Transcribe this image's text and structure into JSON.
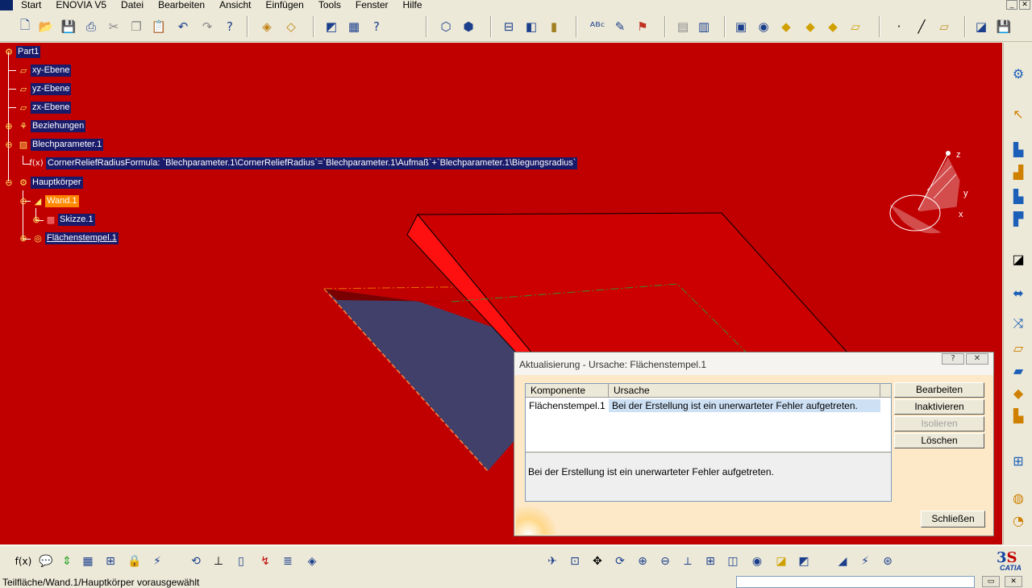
{
  "menu": {
    "items": [
      "Start",
      "ENOVIA V5",
      "Datei",
      "Bearbeiten",
      "Ansicht",
      "Einfügen",
      "Tools",
      "Fenster",
      "Hilfe"
    ]
  },
  "tree": {
    "root": "Part1",
    "items": [
      "xy-Ebene",
      "yz-Ebene",
      "zx-Ebene",
      "Beziehungen",
      "Blechparameter.1",
      "CornerReliefRadiusFormula: `Blechparameter.1\\CornerReliefRadius`=`Blechparameter.1\\Aufmaß`+`Blechparameter.1\\Biegungsradius`",
      "Hauptkörper",
      "Wand.1",
      "Skizze.1",
      "Flächenstempel.1"
    ]
  },
  "compass": {
    "z": "z",
    "y": "y",
    "x": "x"
  },
  "dialog": {
    "title": "Aktualisierung - Ursache: Flächenstempel.1",
    "help_label": "?",
    "close_label": "✕",
    "columns": [
      "Komponente",
      "Ursache"
    ],
    "row": {
      "component": "Flächenstempel.1",
      "cause": "Bei der Erstellung ist ein unerwarteter Fehler aufgetreten."
    },
    "message": "Bei der Erstellung ist ein unerwarteter Fehler aufgetreten.",
    "buttons": {
      "edit": "Bearbeiten",
      "deactivate": "Inaktivieren",
      "isolate": "Isolieren",
      "delete": "Löschen",
      "close": "Schließen"
    }
  },
  "status": {
    "text": "Teilfläche/Wand.1/Hauptkörper vorausgewählt",
    "command_input": ""
  },
  "brand": {
    "catia": "CATIA"
  },
  "colors": {
    "viewport_background": "#c00000",
    "tree_label_background": "#1a1a6a",
    "selected_label": "#ff8800",
    "dialog_background": "#fde8c8",
    "selected_row": "#cde0f4"
  },
  "icons": {
    "top_toolbar": [
      "new-icon",
      "open-icon",
      "save-icon",
      "print-icon",
      "cut-icon",
      "copy-icon",
      "paste-icon",
      "undo-icon",
      "redo-icon",
      "whats-this-icon",
      "catalog-icon",
      "plane-icon",
      "part-icon",
      "measure-icon",
      "spell-icon",
      "sketch-icon",
      "point-icon",
      "line-icon",
      "plane-surface-icon"
    ],
    "right_toolbar": [
      "wall-icon",
      "select-icon",
      "flange-icon",
      "stamp-icon",
      "unfold-icon"
    ],
    "bottom_toolbar": [
      "formula-icon",
      "comment-icon",
      "fit-all-icon",
      "pan-icon",
      "rotate-icon",
      "zoom-in-icon",
      "zoom-out-icon",
      "normal-view-icon",
      "iso-view-icon",
      "shading-icon"
    ]
  }
}
